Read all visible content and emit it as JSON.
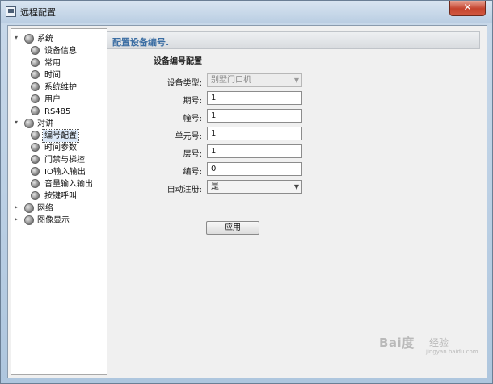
{
  "window": {
    "title": "远程配置",
    "close_label": "✕",
    "icon": "app-window-icon",
    "close_icon": "close-icon"
  },
  "tree": {
    "groups": [
      {
        "label": "系统",
        "expander": "▾",
        "items": [
          "设备信息",
          "常用",
          "时间",
          "系统维护",
          "用户",
          "RS485"
        ]
      },
      {
        "label": "对讲",
        "expander": "▾",
        "items": [
          "编号配置",
          "时间参数",
          "门禁与梯控",
          "IO输入输出",
          "音量输入输出",
          "按键呼叫"
        ]
      },
      {
        "label": "网络",
        "expander": "▸",
        "items": []
      },
      {
        "label": "图像显示",
        "expander": "▸",
        "items": []
      }
    ],
    "selected": "编号配置"
  },
  "content": {
    "header_title": "配置设备编号.",
    "section_title": "设备编号配置",
    "fields": {
      "device_type": {
        "label": "设备类型:",
        "value": "别墅门口机"
      },
      "period": {
        "label": "期号:",
        "value": "1"
      },
      "building": {
        "label": "幢号:",
        "value": "1"
      },
      "unit": {
        "label": "单元号:",
        "value": "1"
      },
      "floor": {
        "label": "层号:",
        "value": "1"
      },
      "number": {
        "label": "编号:",
        "value": "0"
      },
      "auto_register": {
        "label": "自动注册:",
        "value": "是"
      }
    },
    "apply_label": "应用"
  },
  "watermark": {
    "brand": "Bai度",
    "sub": "经验",
    "url": "jingyan.baidu.com"
  },
  "colors": {
    "header_title": "#3c6ea3",
    "titlebar": "#b9cde2",
    "close_button": "#c4432d"
  }
}
